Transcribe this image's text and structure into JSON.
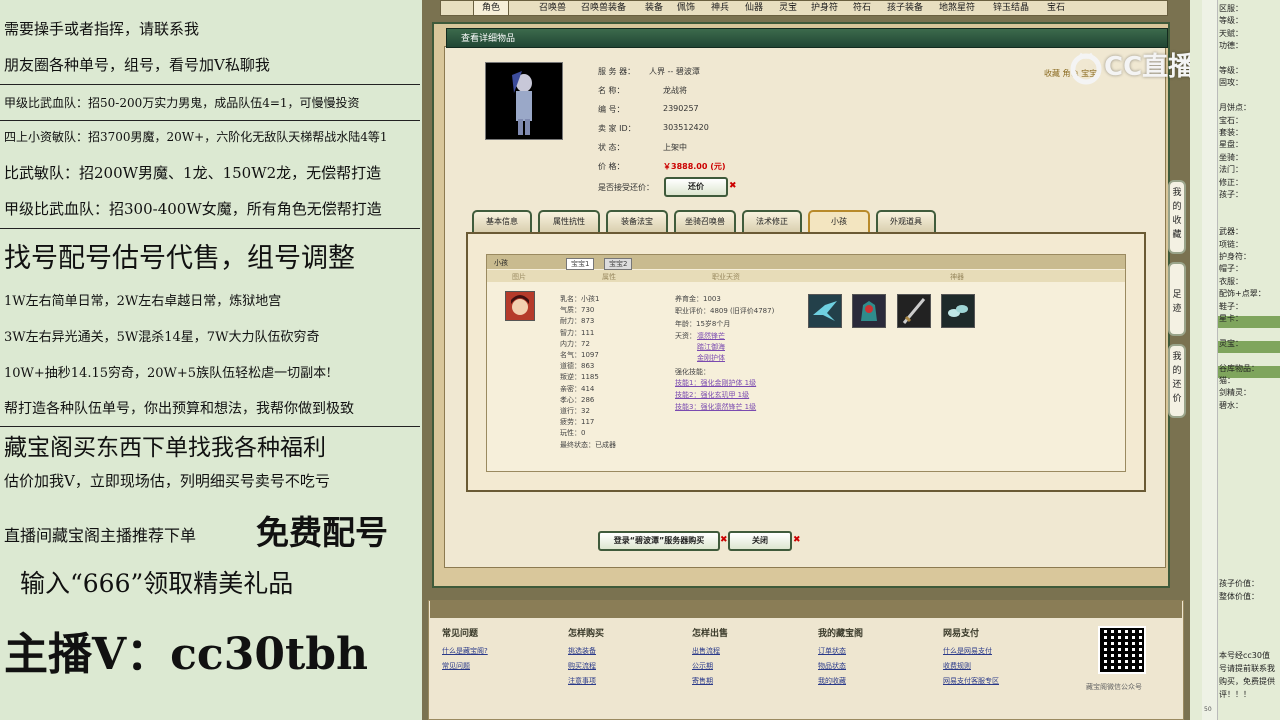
{
  "left_panel": {
    "lines": [
      "需要操手或者指挥，请联系我",
      "朋友圈各种单号，组号，看号加Ⅴ私聊我",
      "甲级比武血队：招50-200万实力男鬼，成品队伍4=1，可慢慢投资",
      "四上小资敏队：招3700男魔，20W+，六阶化无敌队天梯帮战水陆4等1",
      "比武敏队：招200W男魔、1龙、150W2龙，无偿帮打造",
      "甲级比武血队：招300-400W女魔，所有角色无偿帮打造",
      "找号配号估号代售，组号调整",
      "1W左右简单日常，2W左右卓越日常，炼狱地宫",
      "3W左右异光通关，5W混杀14星，7W大力队伍砍穷奇",
      "10W+抽秒14.15穷奇，20W+5族队伍轻松虐一切副本!",
      "帮打造各种队伍单号，你出预算和想法，我帮你做到极致",
      "藏宝阁买东西下单找我各种福利",
      "估价加我V，立即现场估，列明细买号卖号不吃亏",
      "直播间藏宝阁主播推荐下单",
      "免费配号",
      "输入“666”领取精美礼品",
      "主播V：cc30tbh"
    ]
  },
  "top_tabs": [
    "角色",
    "召唤兽",
    "召唤兽装备",
    "装备",
    "佩饰",
    "神兵",
    "仙器",
    "灵宝",
    "护身符",
    "符石",
    "孩子装备",
    "地煞星符",
    "锌玉结晶",
    "宝石"
  ],
  "detail": {
    "header": "查看详细物品",
    "fields": [
      {
        "k": "服 务 器：",
        "v": "人界 -- 碧波潭"
      },
      {
        "k": "名      称：",
        "v": "龙战将"
      },
      {
        "k": "编      号：",
        "v": "2390257"
      },
      {
        "k": "卖 家 ID：",
        "v": "303512420"
      },
      {
        "k": "状      态：",
        "v": "上架中"
      },
      {
        "k": "价      格：",
        "v": "￥3888.00 (元)"
      }
    ],
    "bargain_label": "是否接受还价：",
    "bargain_button": "还价",
    "collect_text": "收藏 角色 宝宝"
  },
  "subtabs": [
    "基本信息",
    "属性抗性",
    "装备法宝",
    "坐骑召唤兽",
    "法术修正",
    "小孩",
    "外观道具"
  ],
  "child_panel": {
    "title": "小孩",
    "inner_tabs": [
      "宝宝1",
      "宝宝2"
    ],
    "col_headers": [
      "图片",
      "属性",
      "职业天资",
      "神器"
    ],
    "stats_a": [
      "乳名：小孩1",
      "气质：730",
      "耐力：873",
      "智力：111",
      "内力：72",
      "名气：1097",
      "道德：863",
      "叛逆：1185",
      "亲密：414",
      "孝心：286",
      "道行：32",
      "疲劳：117",
      "玩性：0",
      "最终状态：已成器"
    ],
    "stats_b": [
      "养育金：1003",
      "职业评价：4809 (旧评价4787)",
      "年龄：15岁8个月",
      "天资："
    ],
    "tianzi": [
      "凛然锋芒",
      "踏江御海",
      "金刚护体"
    ],
    "skill_label": "强化技能：",
    "skills": [
      "技能1：强化金刚护体 1级",
      "技能2：强化玄玑甲 1级",
      "技能3：强化凛然锋芒 1级"
    ]
  },
  "buttons": {
    "buy": "登录“碧波潭”服务器购买",
    "close": "关闭"
  },
  "side_tabs": [
    "我的收藏",
    "足迹",
    "我的还价"
  ],
  "footer": {
    "cols": [
      {
        "h": "常见问题",
        "links": [
          "什么是藏宝阁?",
          "常见问题"
        ]
      },
      {
        "h": "怎样购买",
        "links": [
          "挑选装备",
          "购买流程",
          "注意事项"
        ]
      },
      {
        "h": "怎样出售",
        "links": [
          "出售流程",
          "公示期",
          "寄售期"
        ]
      },
      {
        "h": "我的藏宝阁",
        "links": [
          "订单状态",
          "物品状态",
          "我的收藏"
        ]
      },
      {
        "h": "网易支付",
        "links": [
          "什么是网易支付",
          "收费规则",
          "网易支付客服专区"
        ]
      }
    ],
    "qr_caption": "藏宝阁微信公众号"
  },
  "logo_text": "CC直播",
  "right_panel": {
    "labels": [
      "区服：",
      "等级：",
      "天赋：",
      "功德：",
      "",
      "等级：",
      "固攻：",
      "",
      "月饼点：",
      "宝石：",
      "套装：",
      "星盘：",
      "坐骑：",
      "法门：",
      "修正：",
      "孩子：",
      "",
      "",
      "武器：",
      "项链：",
      "护身符：",
      "帽子：",
      "衣服：",
      "配饰+点翠：",
      "鞋子：",
      "星卡：",
      "",
      "灵宝：",
      "",
      "谷库物品：",
      "猫：",
      "剑精灵：",
      "碧水："
    ],
    "bottom": [
      "孩子价值：",
      "整体价值："
    ],
    "note": [
      "本号经cc30值",
      "号请提前联系我",
      "购买，免费提供",
      "评！！！"
    ],
    "num": "50"
  },
  "colors": {
    "accent": "#c00000",
    "header_green": "#2f5a42",
    "panel": "#dce9d2"
  }
}
